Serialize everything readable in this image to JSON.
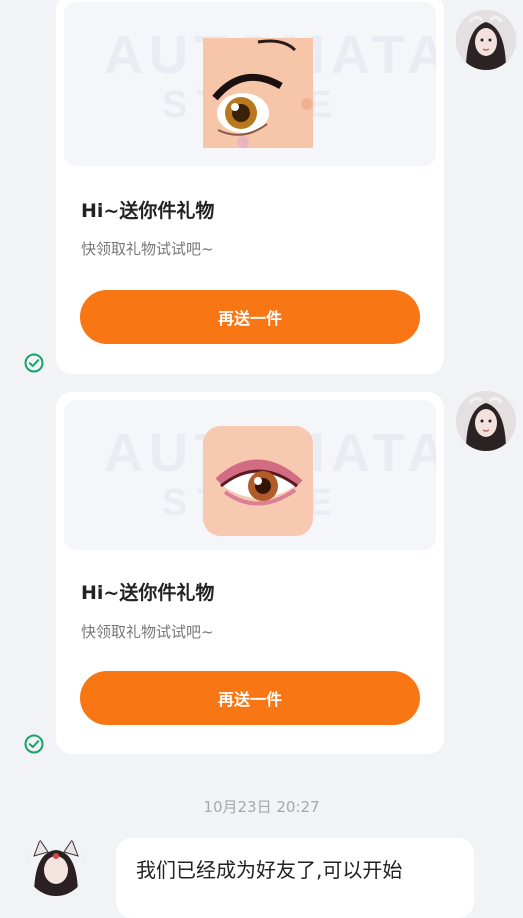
{
  "gift_cards": [
    {
      "title": "Hi~送你件礼物",
      "subtitle": "快领取礼物试试吧~",
      "button_label": "再送一件",
      "icon": "eye-thumbnail",
      "banner_watermark": "AUTOMATA",
      "banner_watermark_sub": "STORE",
      "status_icon": "check-circle-icon"
    },
    {
      "title": "Hi~送你件礼物",
      "subtitle": "快领取礼物试试吧~",
      "button_label": "再送一件",
      "icon": "eye-thumbnail",
      "banner_watermark": "AUTOMATA",
      "banner_watermark_sub": "STORE",
      "status_icon": "check-circle-icon"
    }
  ],
  "timestamp": "10月23日 20:27",
  "incoming_message": {
    "text": "我们已经成为好友了,可以开始"
  },
  "colors": {
    "accent": "#f97614",
    "check": "#16a36a",
    "background": "#f2f3f7"
  }
}
